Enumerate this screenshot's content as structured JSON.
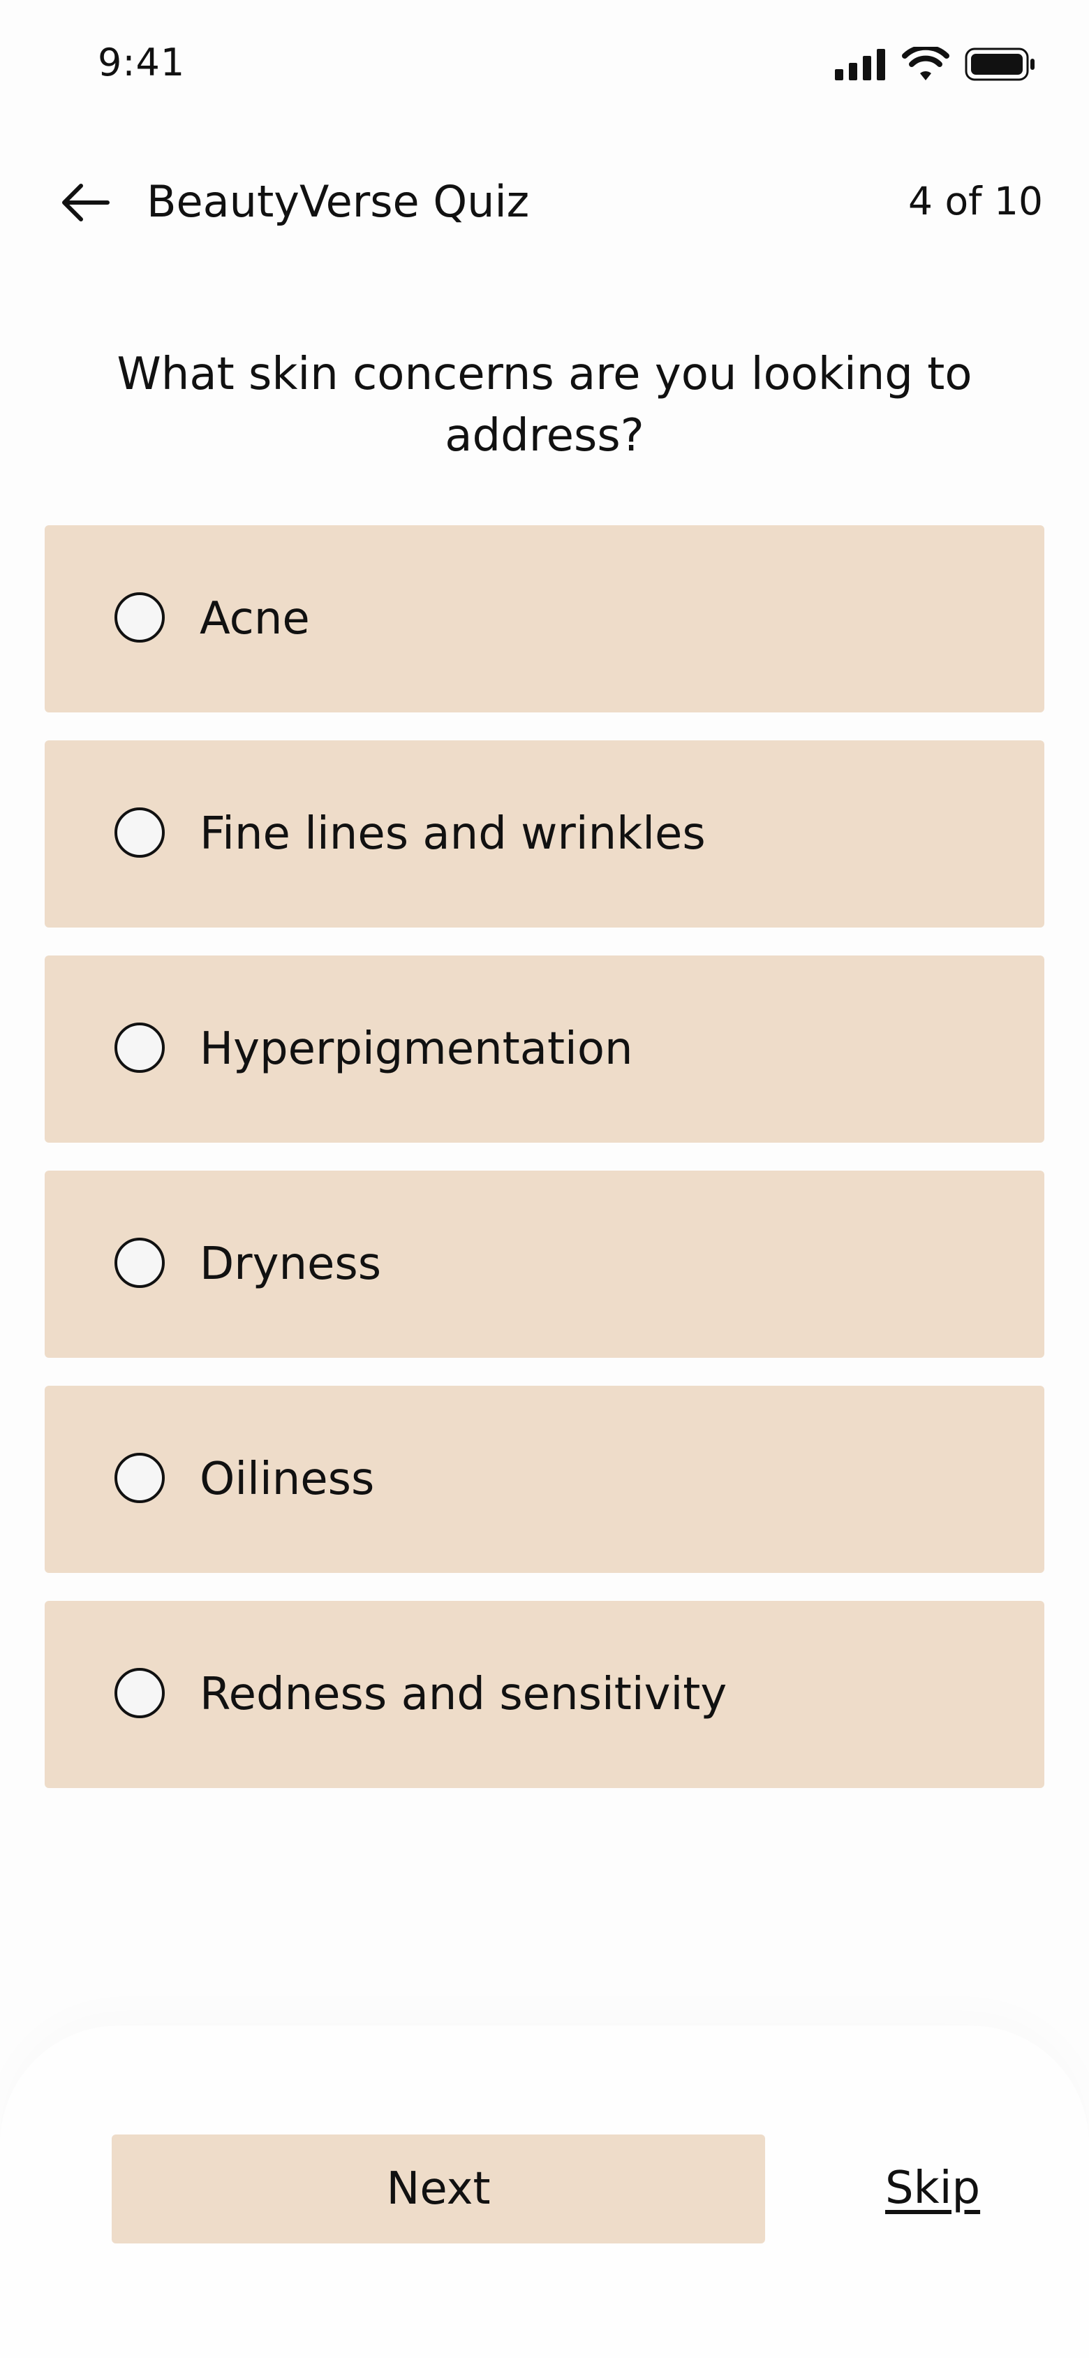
{
  "status_bar": {
    "time": "9:41",
    "icons": [
      "cellular-signal-icon",
      "wifi-icon",
      "battery-icon"
    ]
  },
  "header": {
    "back_icon": "arrow-left-icon",
    "title": "BeautyVerse Quiz",
    "progress": "4 of 10"
  },
  "question": "What skin concerns are you looking to address?",
  "options": [
    {
      "label": "Acne",
      "selected": false
    },
    {
      "label": "Fine lines and wrinkles",
      "selected": false
    },
    {
      "label": "Hyperpigmentation",
      "selected": false
    },
    {
      "label": "Dryness",
      "selected": false
    },
    {
      "label": "Oiliness",
      "selected": false
    },
    {
      "label": "Redness and sensitivity",
      "selected": false
    }
  ],
  "actions": {
    "next_label": "Next",
    "skip_label": "Skip"
  },
  "colors": {
    "option_background": "#eedcc9",
    "text": "#111111",
    "page_background": "#fdfdfd"
  }
}
